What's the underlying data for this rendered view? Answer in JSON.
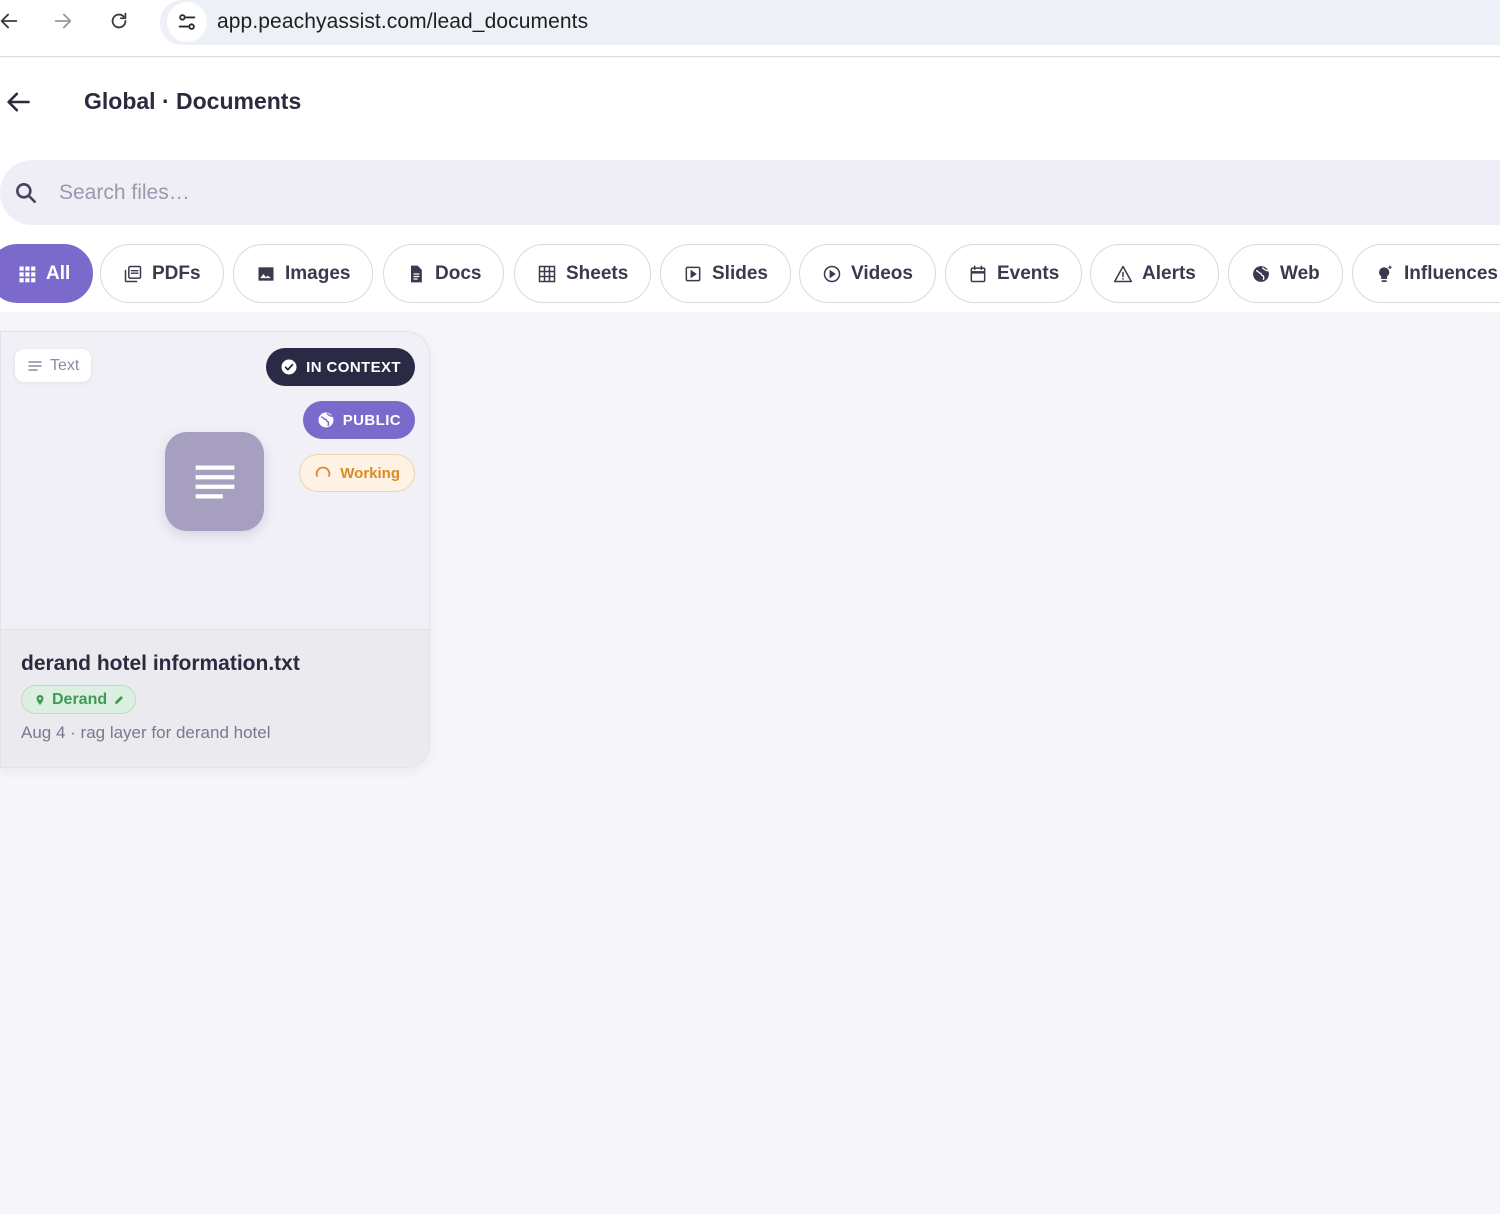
{
  "browser": {
    "url": "app.peachyassist.com/lead_documents"
  },
  "header": {
    "title": "Global · Documents"
  },
  "search": {
    "placeholder": "Search files…",
    "value": ""
  },
  "filters": [
    {
      "label": "All",
      "icon": "grid-icon",
      "active": true
    },
    {
      "label": "PDFs",
      "icon": "pdf-icon",
      "active": false
    },
    {
      "label": "Images",
      "icon": "image-icon",
      "active": false
    },
    {
      "label": "Docs",
      "icon": "document-icon",
      "active": false
    },
    {
      "label": "Sheets",
      "icon": "table-icon",
      "active": false
    },
    {
      "label": "Slides",
      "icon": "slides-icon",
      "active": false
    },
    {
      "label": "Videos",
      "icon": "play-circle-icon",
      "active": false
    },
    {
      "label": "Events",
      "icon": "calendar-icon",
      "active": false
    },
    {
      "label": "Alerts",
      "icon": "warning-icon",
      "active": false
    },
    {
      "label": "Web",
      "icon": "globe-icon",
      "active": false
    },
    {
      "label": "Influences",
      "icon": "lightbulb-icon",
      "active": false
    }
  ],
  "documents": [
    {
      "type_label": "Text",
      "status_context": "IN CONTEXT",
      "status_visibility": "PUBLIC",
      "status_processing": "Working",
      "name": "derand hotel information.txt",
      "location_tag": "Derand",
      "meta": "Aug 4 · rag layer for derand hotel"
    }
  ],
  "colors": {
    "accent": "#7b69cc",
    "dark_pill": "#2b2a45",
    "working": "#d98a26",
    "location_tag": "#3f9a58"
  }
}
